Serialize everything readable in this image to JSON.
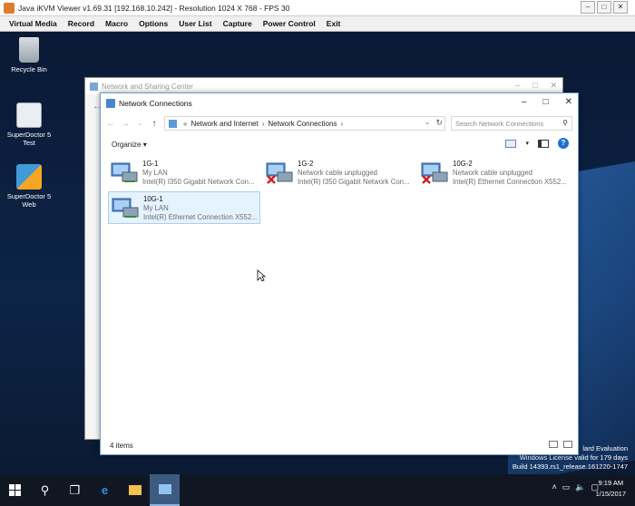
{
  "java": {
    "title": "Java iKVM Viewer v1.69.31 [192.168.10.242]  - Resolution 1024 X 768 - FPS 30",
    "menu": [
      "Virtual Media",
      "Record",
      "Macro",
      "Options",
      "User List",
      "Capture",
      "Power Control",
      "Exit"
    ]
  },
  "desktop": {
    "icons": [
      {
        "label": "Recycle Bin"
      },
      {
        "label": "SuperDoctor 5 Test"
      },
      {
        "label": "SuperDoctor 5 Web"
      }
    ],
    "watermark": {
      "line1": "lard Evaluation",
      "line2": "Windows License valid for 179 days",
      "line3": "Build 14393.rs1_release.161220-1747"
    }
  },
  "bg_window": {
    "title": "Network and Sharing Center"
  },
  "fg_window": {
    "title": "Network Connections",
    "breadcrumb": [
      "Network and Internet",
      "Network Connections"
    ],
    "search_placeholder": "Search Network Connections",
    "organize_label": "Organize",
    "status": "4 items",
    "adapters": [
      {
        "name": "1G-1",
        "status": "My LAN",
        "device": "Intel(R) I350 Gigabit Network Con...",
        "unplugged": false
      },
      {
        "name": "1G-2",
        "status": "Network cable unplugged",
        "device": "Intel(R) I350 Gigabit Network Con...",
        "unplugged": true
      },
      {
        "name": "10G-2",
        "status": "Network cable unplugged",
        "device": "Intel(R) Ethernet Connection X552...",
        "unplugged": true
      },
      {
        "name": "10G-1",
        "status": "My LAN",
        "device": "Intel(R) Ethernet Connection X552...",
        "unplugged": false
      }
    ]
  },
  "taskbar": {
    "time": "9:19 AM",
    "date": "1/15/2017"
  }
}
